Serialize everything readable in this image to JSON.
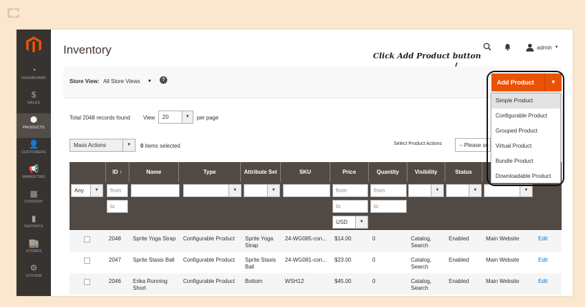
{
  "sidebar": {
    "items": [
      {
        "label": "DASHBOARD",
        "icon": "speedometer-icon",
        "glyph": "◔"
      },
      {
        "label": "SALES",
        "icon": "dollar-icon",
        "glyph": "$"
      },
      {
        "label": "PRODUCTS",
        "icon": "cube-icon",
        "glyph": "⬢"
      },
      {
        "label": "CUSTOMERS",
        "icon": "person-icon",
        "glyph": "👤"
      },
      {
        "label": "MARKETING",
        "icon": "megaphone-icon",
        "glyph": "📢"
      },
      {
        "label": "CONTENT",
        "icon": "layout-icon",
        "glyph": "▦"
      },
      {
        "label": "REPORTS",
        "icon": "bar-chart-icon",
        "glyph": "▮"
      },
      {
        "label": "STORES",
        "icon": "storefront-icon",
        "glyph": "🏬"
      },
      {
        "label": "SYSTEM",
        "icon": "gear-icon",
        "glyph": "⚙"
      }
    ],
    "active_index": 2
  },
  "header": {
    "title": "Inventory",
    "user": "admin"
  },
  "annotation": "Click Add Product button",
  "store_view": {
    "label": "Store View:",
    "value": "All Store Views"
  },
  "add_product": {
    "label": "Add Product",
    "menu": [
      "Simple Product",
      "Configurable Product",
      "Grouped Product",
      "Virtual Product",
      "Bundle Product",
      "Downloadable Product"
    ]
  },
  "grid": {
    "records": "Total 2048 records found",
    "view_label": "View",
    "per_page": "20",
    "per_page_label": "per page",
    "mass_actions": "Mass Actions",
    "selected_count": "0",
    "selected_label": "items selected",
    "select_action_label": "Select Product Actions",
    "select_action_value": "-- Please se",
    "columns": [
      "",
      "ID",
      "Name",
      "Type",
      "Attribute Set",
      "SKU",
      "Price",
      "Quantity",
      "Visibility",
      "Status",
      "",
      ""
    ],
    "filters": {
      "any": "Any",
      "from": "from",
      "to": "to",
      "currency": "USD"
    },
    "rows": [
      {
        "id": "2048",
        "name": "Sprite Yoga Strap",
        "type": "Configurable Product",
        "attr": "Sprite Yoga Strap",
        "sku": "24-WG085-con...",
        "price": "$14.00",
        "qty": "0",
        "visibility": "Catalog, Search",
        "status": "Enabled",
        "website": "Main Website",
        "action": "Edit"
      },
      {
        "id": "2047",
        "name": "Sprite Stasis Ball",
        "type": "Configurable Product",
        "attr": "Sprite Stasis Ball",
        "sku": "24-WG081-con...",
        "price": "$23.00",
        "qty": "0",
        "visibility": "Catalog, Search",
        "status": "Enabled",
        "website": "Main Website",
        "action": "Edit"
      },
      {
        "id": "2046",
        "name": "Erika Running Short",
        "type": "Configurable Product",
        "attr": "Bottom",
        "sku": "WSH12",
        "price": "$45.00",
        "qty": "0",
        "visibility": "Catalog, Search",
        "status": "Enabled",
        "website": "Main Website",
        "action": "Edit"
      }
    ]
  },
  "colors": {
    "sidebar": "#373330",
    "accent": "#eb5202",
    "grid_header": "#514943",
    "link": "#007bdb",
    "background": "#fbe7cd"
  }
}
